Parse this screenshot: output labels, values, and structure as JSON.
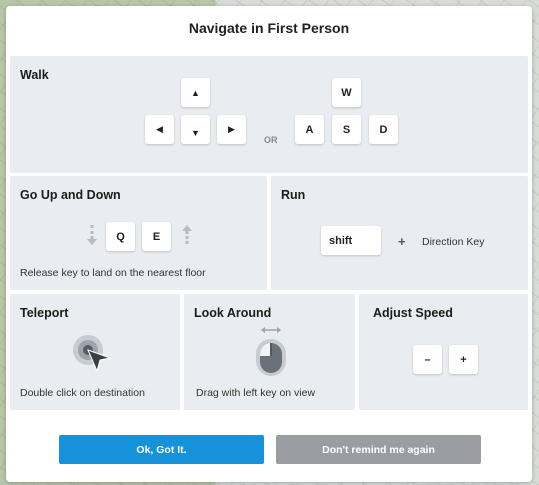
{
  "dialog": {
    "title": "Navigate in First Person"
  },
  "walk": {
    "title": "Walk",
    "arrow_keys": {
      "up": "▲",
      "left": "◀",
      "down": "▼",
      "right": "▶"
    },
    "or_label": "OR",
    "letter_keys": {
      "w": "W",
      "a": "A",
      "s": "S",
      "d": "D"
    }
  },
  "updown": {
    "title": "Go Up and Down",
    "keys": {
      "q": "Q",
      "e": "E"
    },
    "description": "Release key to land on the nearest floor"
  },
  "run": {
    "title": "Run",
    "key": "shift",
    "plus": "+",
    "direction_label": "Direction Key"
  },
  "teleport": {
    "title": "Teleport",
    "description": "Double click on destination"
  },
  "look": {
    "title": "Look Around",
    "description": "Drag with left key on view"
  },
  "speed": {
    "title": "Adjust Speed",
    "minus": "–",
    "plus": "+"
  },
  "buttons": {
    "ok": "Ok, Got It.",
    "dont_remind": "Don't remind me again"
  },
  "colors": {
    "primary": "#1592d9",
    "secondary": "#9a9ea3",
    "panel": "#e9ecf0"
  }
}
